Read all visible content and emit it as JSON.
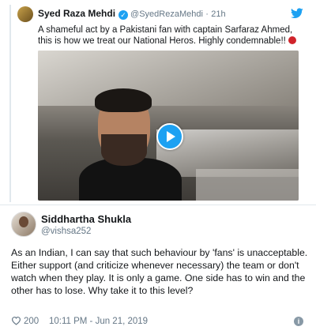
{
  "quoted_tweet": {
    "author_name": "Syed Raza Mehdi",
    "author_handle": "@SyedRezaMehdi",
    "separator": "·",
    "time": "21h",
    "text": "A shameful act by a Pakistani fan with captain Sarfaraz Ahmed, this is how we treat our National Heros. Highly condemnable!!",
    "icons": {
      "verified": "verified-badge-icon",
      "bird": "twitter-bird-icon",
      "play": "play-icon",
      "emoji": "red-circle-emoji-icon"
    }
  },
  "main_tweet": {
    "author_name": "Siddhartha Shukla",
    "author_handle": "@vishsa252",
    "text": "As an Indian, I can say that such behaviour by 'fans' is unacceptable. Either support (and criticize whenever necessary) the team or don't watch when they play. It is only a game. One side has to win and the other has to lose. Why take it to this level?",
    "like_count": "200",
    "timestamp": "10:11 PM - Jun 21, 2019",
    "icons": {
      "like": "heart-icon",
      "info": "info-icon"
    }
  },
  "colors": {
    "accent": "#1da1f2",
    "muted": "#657786",
    "text": "#14171a",
    "divider": "#e1e8ed"
  }
}
